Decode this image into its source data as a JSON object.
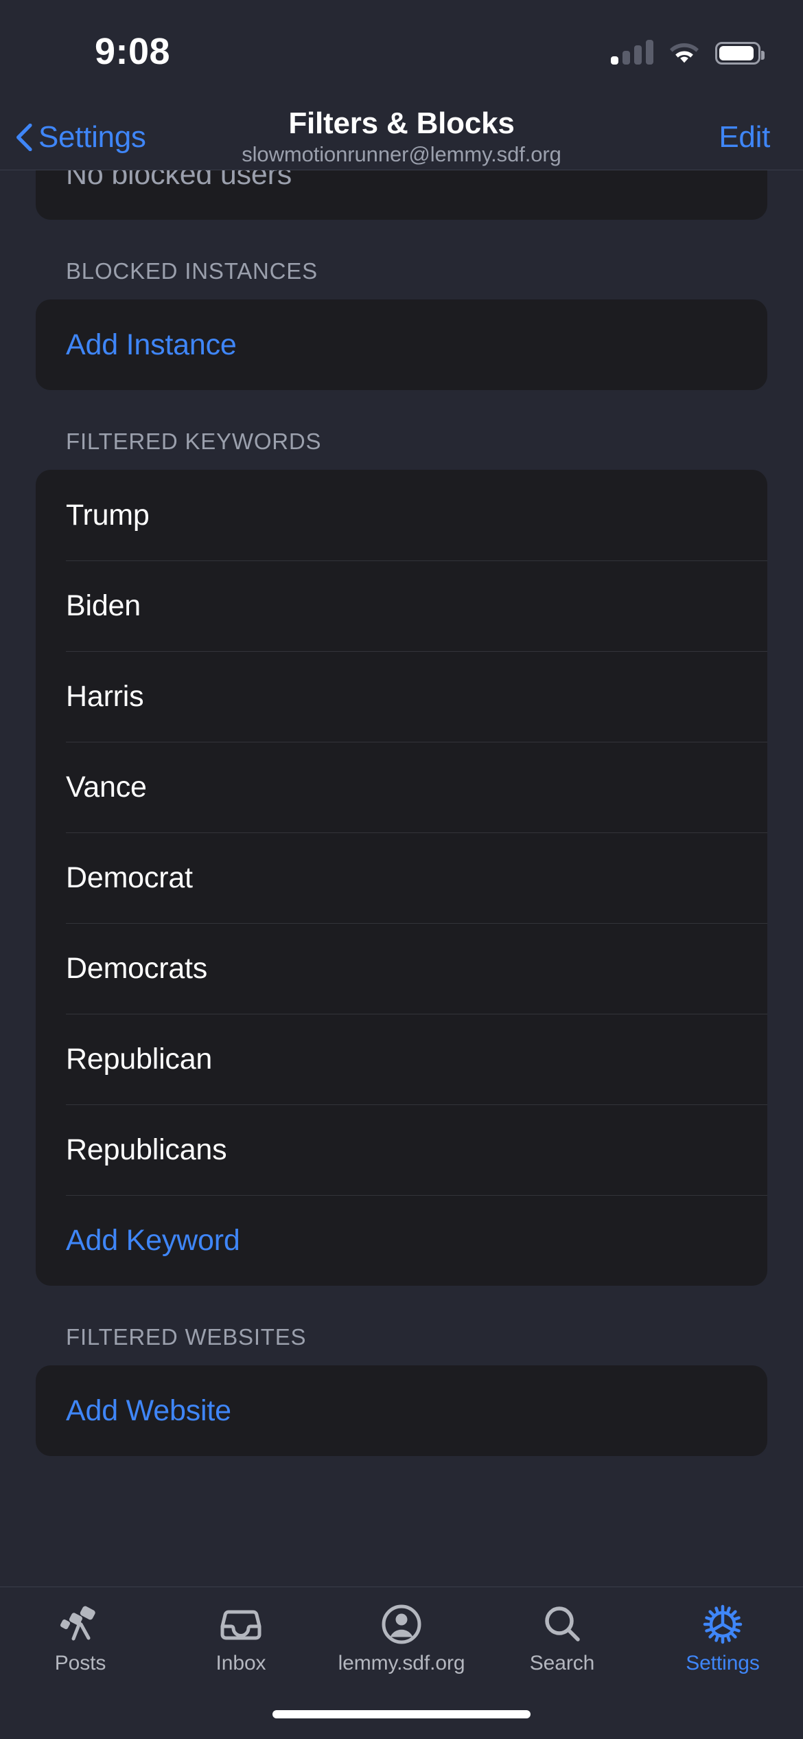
{
  "status_bar": {
    "time": "9:08",
    "cellular_icon": "cellular-signal-icon",
    "cellular_bars_filled": 1,
    "cellular_bars_total": 4,
    "wifi_icon": "wifi-icon",
    "battery_icon": "battery-icon",
    "battery_level_percent": 92
  },
  "nav_bar": {
    "back_icon": "chevron-left-icon",
    "back_label": "Settings",
    "title": "Filters & Blocks",
    "subtitle": "slowmotionrunner@lemmy.sdf.org",
    "edit_label": "Edit"
  },
  "sections": {
    "blocked_users": {
      "empty_label": "No blocked users"
    },
    "blocked_instances": {
      "header": "BLOCKED INSTANCES",
      "add_label": "Add Instance"
    },
    "filtered_keywords": {
      "header": "FILTERED KEYWORDS",
      "items": [
        "Trump",
        "Biden",
        "Harris",
        "Vance",
        "Democrat",
        "Democrats",
        "Republican",
        "Republicans"
      ],
      "add_label": "Add Keyword"
    },
    "filtered_websites": {
      "header": "FILTERED WEBSITES",
      "add_label": "Add Website"
    }
  },
  "tab_bar": {
    "tabs": [
      {
        "label": "Posts",
        "icon": "telescope-icon",
        "active": false
      },
      {
        "label": "Inbox",
        "icon": "tray-icon",
        "active": false
      },
      {
        "label": "lemmy.sdf.org",
        "icon": "person-circle-icon",
        "active": false
      },
      {
        "label": "Search",
        "icon": "magnifying-glass-icon",
        "active": false
      },
      {
        "label": "Settings",
        "icon": "gear-icon",
        "active": true
      }
    ]
  },
  "colors": {
    "accent_blue": "#3F86F8",
    "page_background": "#262833",
    "card_background": "#1C1C20",
    "secondary_text": "#9ba0ad",
    "primary_text": "#ffffff",
    "separator": "#33343a"
  },
  "home_indicator": "home-indicator"
}
